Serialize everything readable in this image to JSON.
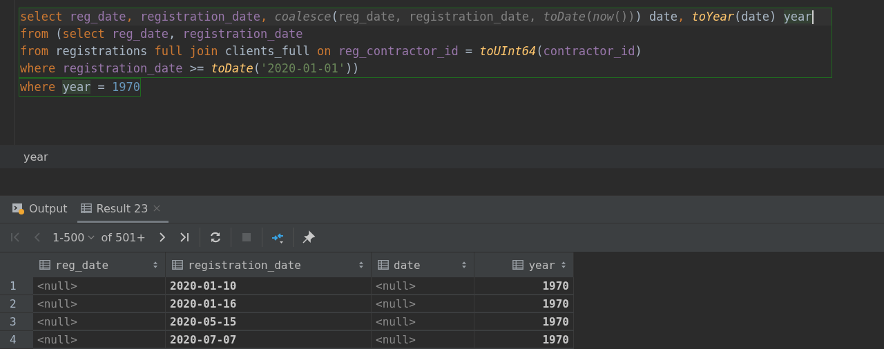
{
  "editor": {
    "statements": [
      {
        "lines": [
          {
            "current": true,
            "tokens": [
              {
                "kind": "keyword",
                "text": "select "
              },
              {
                "kind": "column",
                "text": "reg_date"
              },
              {
                "kind": "keyword",
                "text": ", "
              },
              {
                "kind": "column",
                "text": "registration_date"
              },
              {
                "kind": "keyword",
                "text": ", "
              },
              {
                "kind": "dim-italic",
                "text": "coalesce"
              },
              {
                "kind": "plain",
                "text": "("
              },
              {
                "kind": "dim",
                "text": "reg_date, registration_date, "
              },
              {
                "kind": "dim-italic",
                "text": "toDate"
              },
              {
                "kind": "dim",
                "text": "("
              },
              {
                "kind": "dim-italic",
                "text": "now"
              },
              {
                "kind": "dim",
                "text": "())"
              },
              {
                "kind": "plain",
                "text": ") date"
              },
              {
                "kind": "keyword",
                "text": ", "
              },
              {
                "kind": "function",
                "text": "toYear"
              },
              {
                "kind": "plain",
                "text": "(date) "
              },
              {
                "kind": "highlight",
                "text": "year"
              }
            ]
          },
          {
            "current": false,
            "tokens": [
              {
                "kind": "keyword",
                "text": "from "
              },
              {
                "kind": "plain",
                "text": "("
              },
              {
                "kind": "keyword",
                "text": "select "
              },
              {
                "kind": "column",
                "text": "reg_date"
              },
              {
                "kind": "plain",
                "text": ", "
              },
              {
                "kind": "column",
                "text": "registration_date"
              }
            ]
          },
          {
            "current": false,
            "tokens": [
              {
                "kind": "keyword",
                "text": "from "
              },
              {
                "kind": "plain",
                "text": "registrations "
              },
              {
                "kind": "keyword",
                "text": "full join "
              },
              {
                "kind": "plain",
                "text": "clients_full "
              },
              {
                "kind": "keyword",
                "text": "on "
              },
              {
                "kind": "column",
                "text": "reg_contractor_id"
              },
              {
                "kind": "plain",
                "text": " = "
              },
              {
                "kind": "function",
                "text": "toUInt64"
              },
              {
                "kind": "plain",
                "text": "("
              },
              {
                "kind": "column",
                "text": "contractor_id"
              },
              {
                "kind": "plain",
                "text": ")"
              }
            ]
          },
          {
            "current": false,
            "tokens": [
              {
                "kind": "keyword",
                "text": "where "
              },
              {
                "kind": "column",
                "text": "registration_date"
              },
              {
                "kind": "plain",
                "text": " >= "
              },
              {
                "kind": "function",
                "text": "toDate"
              },
              {
                "kind": "plain",
                "text": "("
              },
              {
                "kind": "string",
                "text": "'2020-01-01'"
              },
              {
                "kind": "plain",
                "text": "))"
              }
            ]
          }
        ]
      },
      {
        "lines": [
          {
            "current": false,
            "tokens": [
              {
                "kind": "keyword",
                "text": "where "
              },
              {
                "kind": "highlight",
                "text": "year"
              },
              {
                "kind": "plain",
                "text": " = "
              },
              {
                "kind": "number",
                "text": "1970"
              }
            ]
          }
        ]
      }
    ]
  },
  "breadcrumb": "year",
  "tabs": [
    {
      "label": "Output",
      "kind": "output",
      "selected": false
    },
    {
      "label": "Result 23",
      "kind": "result",
      "selected": true
    }
  ],
  "toolbar": {
    "range": "1-500",
    "total": "of 501+"
  },
  "table": {
    "columns": [
      {
        "label": "reg_date",
        "kind": "text"
      },
      {
        "label": "registration_date",
        "kind": "text"
      },
      {
        "label": "date",
        "kind": "text"
      },
      {
        "label": "year",
        "kind": "number"
      }
    ],
    "rows": [
      {
        "number": "1",
        "cells": [
          {
            "text": "<null>",
            "null": true
          },
          {
            "text": "2020-01-10",
            "null": false
          },
          {
            "text": "<null>",
            "null": true
          },
          {
            "text": "1970",
            "null": false
          }
        ]
      },
      {
        "number": "2",
        "cells": [
          {
            "text": "<null>",
            "null": true
          },
          {
            "text": "2020-01-16",
            "null": false
          },
          {
            "text": "<null>",
            "null": true
          },
          {
            "text": "1970",
            "null": false
          }
        ]
      },
      {
        "number": "3",
        "cells": [
          {
            "text": "<null>",
            "null": true
          },
          {
            "text": "2020-05-15",
            "null": false
          },
          {
            "text": "<null>",
            "null": true
          },
          {
            "text": "1970",
            "null": false
          }
        ]
      },
      {
        "number": "4",
        "cells": [
          {
            "text": "<null>",
            "null": true
          },
          {
            "text": "2020-07-07",
            "null": false
          },
          {
            "text": "<null>",
            "null": true
          },
          {
            "text": "1970",
            "null": false
          }
        ]
      }
    ]
  }
}
